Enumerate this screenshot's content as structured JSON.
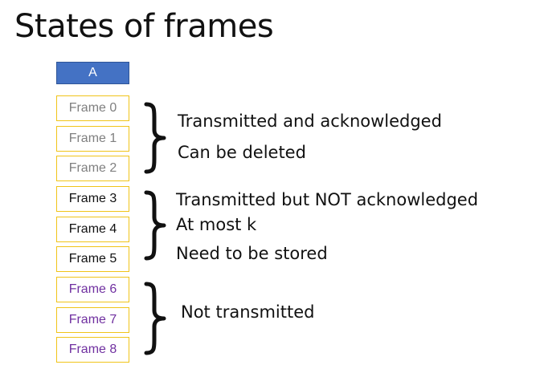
{
  "title": "States of frames",
  "header": "A",
  "frames": [
    "Frame 0",
    "Frame 1",
    "Frame 2",
    "Frame 3",
    "Frame 4",
    "Frame 5",
    "Frame 6",
    "Frame 7",
    "Frame 8"
  ],
  "groups": [
    {
      "state": "done",
      "lines": [
        "Transmitted and acknowledged",
        "Can be deleted"
      ]
    },
    {
      "state": "pending",
      "lines": [
        "Transmitted but NOT acknowledged",
        "At most k",
        "Need to be stored"
      ]
    },
    {
      "state": "future",
      "lines": [
        "Not transmitted"
      ]
    }
  ],
  "colors": {
    "header_fill": "#4472c4",
    "frame_border": "#f0c419",
    "done_text": "#7f7f7f",
    "pending_text": "#111111",
    "future_text": "#7030a0"
  }
}
